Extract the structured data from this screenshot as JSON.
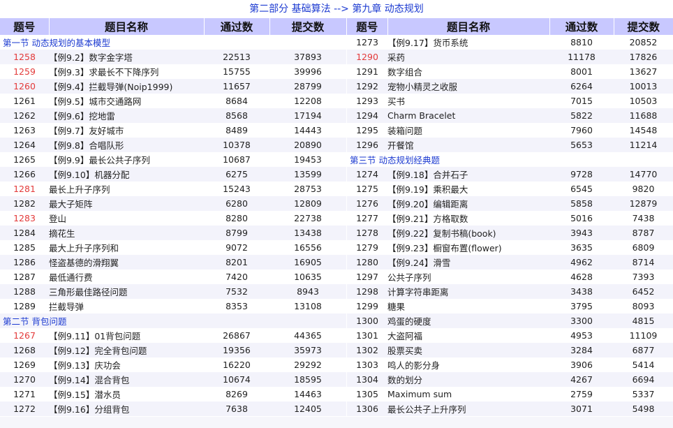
{
  "page_title": "第二部分 基础算法 --> 第九章 动态规划",
  "headers": {
    "id": "题号",
    "name": "题目名称",
    "passed": "通过数",
    "submitted": "提交数"
  },
  "left_rows": [
    {
      "type": "section",
      "text": "第一节 动态规划的基本模型"
    },
    {
      "id": "1258",
      "name": "【例9.2】数字金字塔",
      "passed": "22513",
      "submitted": "37893",
      "highlight": true
    },
    {
      "id": "1259",
      "name": "【例9.3】求最长不下降序列",
      "passed": "15755",
      "submitted": "39996",
      "highlight": true
    },
    {
      "id": "1260",
      "name": "【例9.4】拦截导弹(Noip1999)",
      "passed": "11657",
      "submitted": "28799",
      "highlight": true
    },
    {
      "id": "1261",
      "name": "【例9.5】城市交通路网",
      "passed": "8684",
      "submitted": "12208"
    },
    {
      "id": "1262",
      "name": "【例9.6】挖地雷",
      "passed": "8568",
      "submitted": "17194"
    },
    {
      "id": "1263",
      "name": "【例9.7】友好城市",
      "passed": "8489",
      "submitted": "14443"
    },
    {
      "id": "1264",
      "name": "【例9.8】合唱队形",
      "passed": "10378",
      "submitted": "20890"
    },
    {
      "id": "1265",
      "name": "【例9.9】最长公共子序列",
      "passed": "10687",
      "submitted": "19453"
    },
    {
      "id": "1266",
      "name": "【例9.10】机器分配",
      "passed": "6275",
      "submitted": "13599"
    },
    {
      "id": "1281",
      "name": "最长上升子序列",
      "passed": "15243",
      "submitted": "28753",
      "highlight": true
    },
    {
      "id": "1282",
      "name": "最大子矩阵",
      "passed": "6280",
      "submitted": "12809"
    },
    {
      "id": "1283",
      "name": "登山",
      "passed": "8280",
      "submitted": "22738",
      "highlight": true
    },
    {
      "id": "1284",
      "name": "摘花生",
      "passed": "8799",
      "submitted": "13438"
    },
    {
      "id": "1285",
      "name": "最大上升子序列和",
      "passed": "9072",
      "submitted": "16556"
    },
    {
      "id": "1286",
      "name": "怪盗基德的滑翔翼",
      "passed": "8201",
      "submitted": "16905"
    },
    {
      "id": "1287",
      "name": "最低通行费",
      "passed": "7420",
      "submitted": "10635"
    },
    {
      "id": "1288",
      "name": "三角形最佳路径问题",
      "passed": "7532",
      "submitted": "8943"
    },
    {
      "id": "1289",
      "name": "拦截导弹",
      "passed": "8353",
      "submitted": "13108"
    },
    {
      "type": "section",
      "text": "第二节 背包问题"
    },
    {
      "id": "1267",
      "name": "【例9.11】01背包问题",
      "passed": "26867",
      "submitted": "44365",
      "highlight": true
    },
    {
      "id": "1268",
      "name": "【例9.12】完全背包问题",
      "passed": "19356",
      "submitted": "35973"
    },
    {
      "id": "1269",
      "name": "【例9.13】庆功会",
      "passed": "16220",
      "submitted": "29292"
    },
    {
      "id": "1270",
      "name": "【例9.14】混合背包",
      "passed": "10674",
      "submitted": "18595"
    },
    {
      "id": "1271",
      "name": "【例9.15】潜水员",
      "passed": "8269",
      "submitted": "14463"
    },
    {
      "id": "1272",
      "name": "【例9.16】分组背包",
      "passed": "7638",
      "submitted": "12405"
    }
  ],
  "right_rows": [
    {
      "id": "1273",
      "name": "【例9.17】货币系统",
      "passed": "8810",
      "submitted": "20852"
    },
    {
      "id": "1290",
      "name": "采药",
      "passed": "11178",
      "submitted": "17826",
      "highlight": true
    },
    {
      "id": "1291",
      "name": "数字组合",
      "passed": "8001",
      "submitted": "13627"
    },
    {
      "id": "1292",
      "name": "宠物小精灵之收服",
      "passed": "6264",
      "submitted": "10013"
    },
    {
      "id": "1293",
      "name": "买书",
      "passed": "7015",
      "submitted": "10503"
    },
    {
      "id": "1294",
      "name": "Charm Bracelet",
      "passed": "5822",
      "submitted": "11688"
    },
    {
      "id": "1295",
      "name": "装箱问题",
      "passed": "7960",
      "submitted": "14548"
    },
    {
      "id": "1296",
      "name": "开餐馆",
      "passed": "5653",
      "submitted": "11214"
    },
    {
      "type": "section",
      "text": "第三节 动态规划经典题"
    },
    {
      "id": "1274",
      "name": "【例9.18】合并石子",
      "passed": "9728",
      "submitted": "14770"
    },
    {
      "id": "1275",
      "name": "【例9.19】乘积最大",
      "passed": "6545",
      "submitted": "9820"
    },
    {
      "id": "1276",
      "name": "【例9.20】编辑距离",
      "passed": "5858",
      "submitted": "12879"
    },
    {
      "id": "1277",
      "name": "【例9.21】方格取数",
      "passed": "5016",
      "submitted": "7438"
    },
    {
      "id": "1278",
      "name": "【例9.22】复制书稿(book)",
      "passed": "3943",
      "submitted": "8787"
    },
    {
      "id": "1279",
      "name": "【例9.23】橱窗布置(flower)",
      "passed": "3635",
      "submitted": "6809"
    },
    {
      "id": "1280",
      "name": "【例9.24】滑雪",
      "passed": "4962",
      "submitted": "8714"
    },
    {
      "id": "1297",
      "name": "公共子序列",
      "passed": "4628",
      "submitted": "7393"
    },
    {
      "id": "1298",
      "name": "计算字符串距离",
      "passed": "3438",
      "submitted": "6452"
    },
    {
      "id": "1299",
      "name": "糖果",
      "passed": "3795",
      "submitted": "8093"
    },
    {
      "id": "1300",
      "name": "鸡蛋的硬度",
      "passed": "3300",
      "submitted": "4815"
    },
    {
      "id": "1301",
      "name": "大盗阿福",
      "passed": "4953",
      "submitted": "11109"
    },
    {
      "id": "1302",
      "name": "股票买卖",
      "passed": "3284",
      "submitted": "6877"
    },
    {
      "id": "1303",
      "name": "鸣人的影分身",
      "passed": "3906",
      "submitted": "5414"
    },
    {
      "id": "1304",
      "name": "数的划分",
      "passed": "4267",
      "submitted": "6694"
    },
    {
      "id": "1305",
      "name": "Maximum sum",
      "passed": "2759",
      "submitted": "5337"
    },
    {
      "id": "1306",
      "name": "最长公共子上升序列",
      "passed": "3071",
      "submitted": "5498"
    }
  ],
  "colors": {
    "link": "#1d3bd1",
    "highlight_id": "#e33a3a",
    "header_bg": "#c8c8ff",
    "row_alt": "#f3f3fb"
  }
}
